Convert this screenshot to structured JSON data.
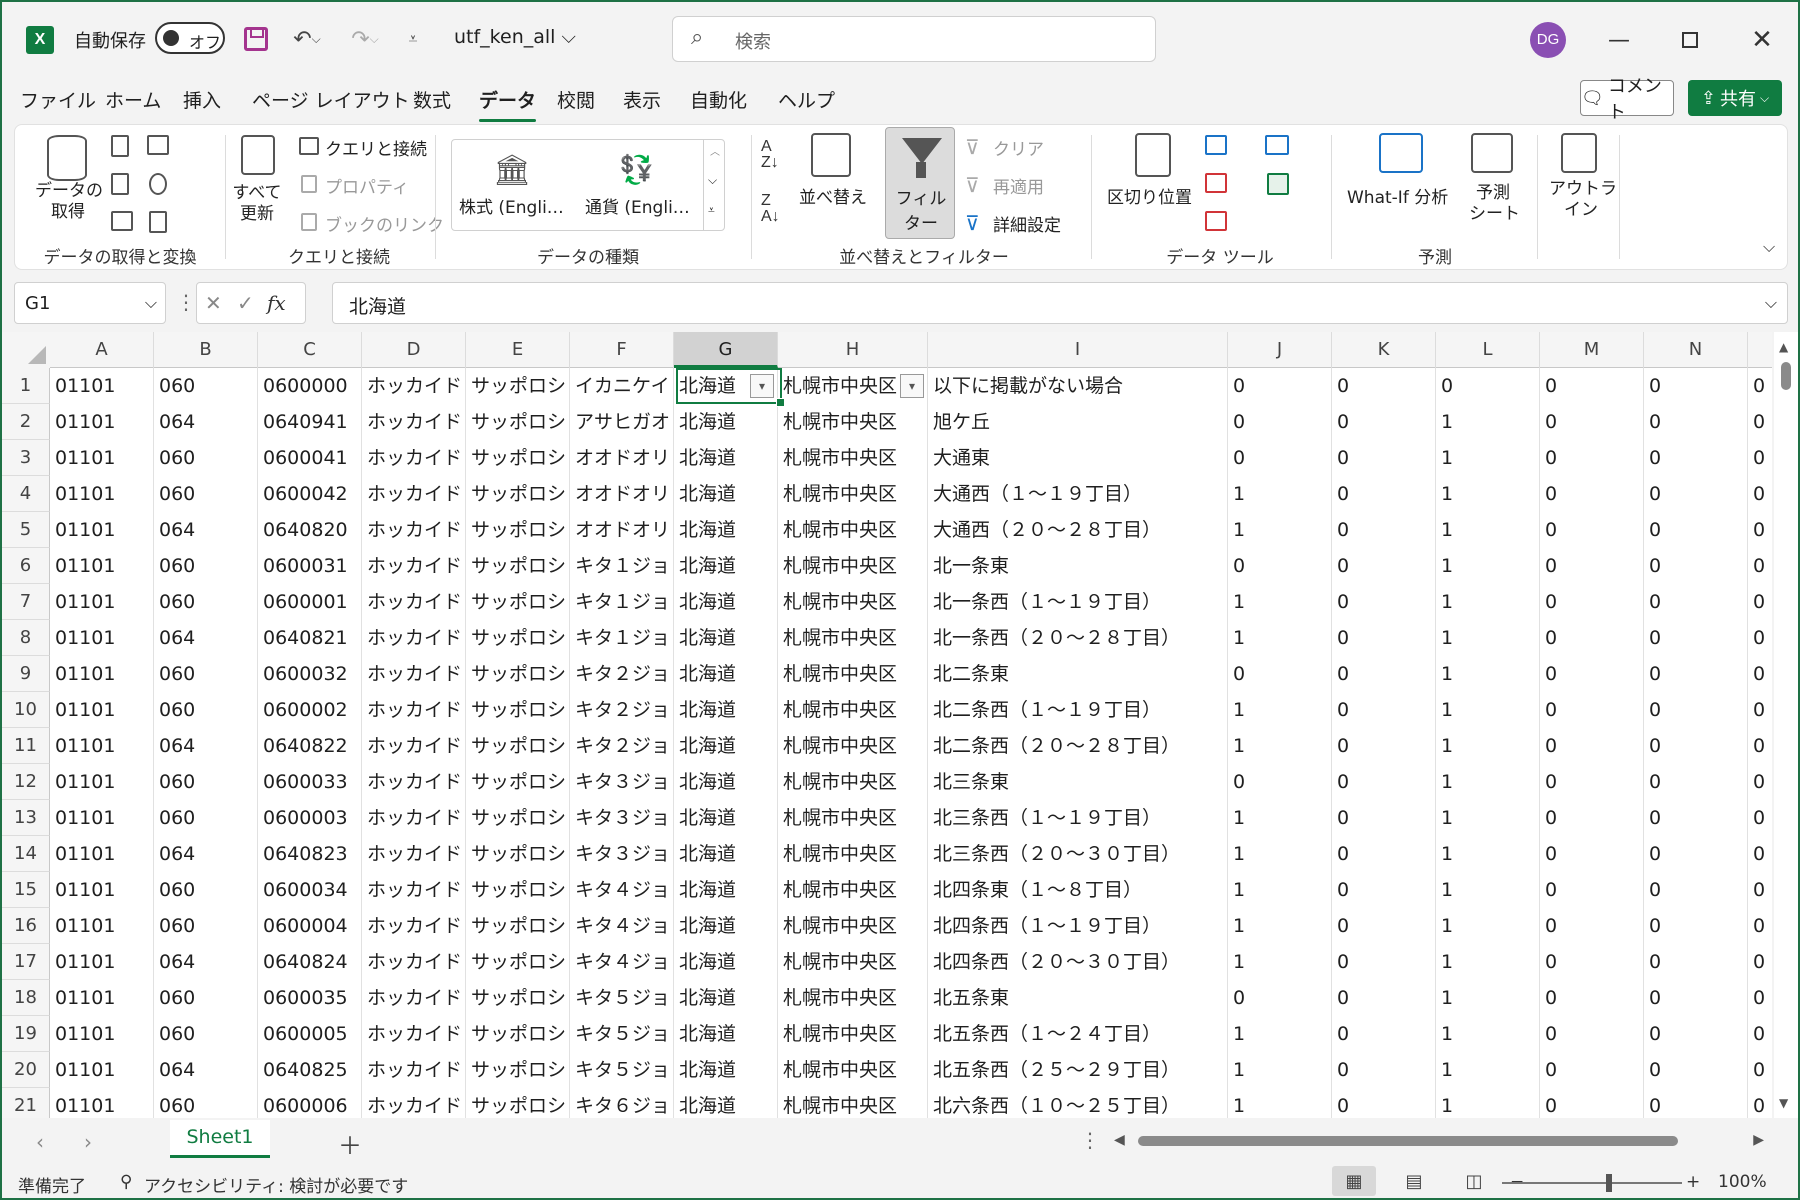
{
  "titlebar": {
    "autosave_label": "自動保存",
    "autosave_state": "オフ",
    "doc_name": "utf_ken_all ⌵",
    "search_placeholder": "検索",
    "avatar_initials": "DG"
  },
  "tabs": [
    "ファイル",
    "ホーム",
    "挿入",
    "ページ レイアウト",
    "数式",
    "データ",
    "校閲",
    "表示",
    "自動化",
    "ヘルプ"
  ],
  "active_tab": "データ",
  "comment_label": "コメント",
  "share_label": "共有",
  "ribbon": {
    "get_data": "データの\n取得",
    "group_get_transform": "データの取得と変換",
    "refresh_all": "すべて\n更新",
    "queries_connections": "クエリと接続",
    "properties": "プロパティ",
    "book_links": "ブックのリンク",
    "group_queries": "クエリと接続",
    "stocks": "株式 (Engli…",
    "currencies": "通貨 (Engli…",
    "group_datatypes": "データの種類",
    "sort": "並べ替え",
    "filter": "フィルター",
    "clear": "クリア",
    "reapply": "再適用",
    "advanced": "詳細設定",
    "group_sort_filter": "並べ替えとフィルター",
    "text_to_columns": "区切り位置",
    "group_data_tools": "データ ツール",
    "whatif": "What-If 分析",
    "forecast_sheet": "予測\nシート",
    "group_forecast": "予測",
    "outline": "アウトラ\nイン"
  },
  "formula_bar": {
    "name_box": "G1",
    "formula": "北海道"
  },
  "grid": {
    "columns": [
      "A",
      "B",
      "C",
      "D",
      "E",
      "F",
      "G",
      "H",
      "I",
      "J",
      "K",
      "L",
      "M",
      "N"
    ],
    "selected_column": "G",
    "selected_cell": "G1",
    "row_numbers": [
      "1",
      "2",
      "3",
      "4",
      "5",
      "6",
      "7",
      "8",
      "9",
      "10",
      "11",
      "12",
      "13",
      "14",
      "15",
      "16",
      "17",
      "18",
      "19",
      "20",
      "21"
    ],
    "rows": [
      [
        "01101",
        "060",
        "0600000",
        "ホッカイド",
        "サッポロシ",
        "イカニケイ",
        "北海道",
        "札幌市中央区",
        "以下に掲載がない場合",
        "0",
        "0",
        "0",
        "0",
        "0",
        "0"
      ],
      [
        "01101",
        "064",
        "0640941",
        "ホッカイド",
        "サッポロシ",
        "アサヒガオ",
        "北海道",
        "札幌市中央区",
        "旭ケ丘",
        "0",
        "0",
        "1",
        "0",
        "0",
        "0"
      ],
      [
        "01101",
        "060",
        "0600041",
        "ホッカイド",
        "サッポロシ",
        "オオドオリ",
        "北海道",
        "札幌市中央区",
        "大通東",
        "0",
        "0",
        "1",
        "0",
        "0",
        "0"
      ],
      [
        "01101",
        "060",
        "0600042",
        "ホッカイド",
        "サッポロシ",
        "オオドオリ",
        "北海道",
        "札幌市中央区",
        "大通西（１～１９丁目）",
        "1",
        "0",
        "1",
        "0",
        "0",
        "0"
      ],
      [
        "01101",
        "064",
        "0640820",
        "ホッカイド",
        "サッポロシ",
        "オオドオリ",
        "北海道",
        "札幌市中央区",
        "大通西（２０～２８丁目）",
        "1",
        "0",
        "1",
        "0",
        "0",
        "0"
      ],
      [
        "01101",
        "060",
        "0600031",
        "ホッカイド",
        "サッポロシ",
        "キタ１ジョ",
        "北海道",
        "札幌市中央区",
        "北一条東",
        "0",
        "0",
        "1",
        "0",
        "0",
        "0"
      ],
      [
        "01101",
        "060",
        "0600001",
        "ホッカイド",
        "サッポロシ",
        "キタ１ジョ",
        "北海道",
        "札幌市中央区",
        "北一条西（１～１９丁目）",
        "1",
        "0",
        "1",
        "0",
        "0",
        "0"
      ],
      [
        "01101",
        "064",
        "0640821",
        "ホッカイド",
        "サッポロシ",
        "キタ１ジョ",
        "北海道",
        "札幌市中央区",
        "北一条西（２０～２８丁目）",
        "1",
        "0",
        "1",
        "0",
        "0",
        "0"
      ],
      [
        "01101",
        "060",
        "0600032",
        "ホッカイド",
        "サッポロシ",
        "キタ２ジョ",
        "北海道",
        "札幌市中央区",
        "北二条東",
        "0",
        "0",
        "1",
        "0",
        "0",
        "0"
      ],
      [
        "01101",
        "060",
        "0600002",
        "ホッカイド",
        "サッポロシ",
        "キタ２ジョ",
        "北海道",
        "札幌市中央区",
        "北二条西（１～１９丁目）",
        "1",
        "0",
        "1",
        "0",
        "0",
        "0"
      ],
      [
        "01101",
        "064",
        "0640822",
        "ホッカイド",
        "サッポロシ",
        "キタ２ジョ",
        "北海道",
        "札幌市中央区",
        "北二条西（２０～２８丁目）",
        "1",
        "0",
        "1",
        "0",
        "0",
        "0"
      ],
      [
        "01101",
        "060",
        "0600033",
        "ホッカイド",
        "サッポロシ",
        "キタ３ジョ",
        "北海道",
        "札幌市中央区",
        "北三条東",
        "0",
        "0",
        "1",
        "0",
        "0",
        "0"
      ],
      [
        "01101",
        "060",
        "0600003",
        "ホッカイド",
        "サッポロシ",
        "キタ３ジョ",
        "北海道",
        "札幌市中央区",
        "北三条西（１～１９丁目）",
        "1",
        "0",
        "1",
        "0",
        "0",
        "0"
      ],
      [
        "01101",
        "064",
        "0640823",
        "ホッカイド",
        "サッポロシ",
        "キタ３ジョ",
        "北海道",
        "札幌市中央区",
        "北三条西（２０～３０丁目）",
        "1",
        "0",
        "1",
        "0",
        "0",
        "0"
      ],
      [
        "01101",
        "060",
        "0600034",
        "ホッカイド",
        "サッポロシ",
        "キタ４ジョ",
        "北海道",
        "札幌市中央区",
        "北四条東（１～８丁目）",
        "1",
        "0",
        "1",
        "0",
        "0",
        "0"
      ],
      [
        "01101",
        "060",
        "0600004",
        "ホッカイド",
        "サッポロシ",
        "キタ４ジョ",
        "北海道",
        "札幌市中央区",
        "北四条西（１～１９丁目）",
        "1",
        "0",
        "1",
        "0",
        "0",
        "0"
      ],
      [
        "01101",
        "064",
        "0640824",
        "ホッカイド",
        "サッポロシ",
        "キタ４ジョ",
        "北海道",
        "札幌市中央区",
        "北四条西（２０～３０丁目）",
        "1",
        "0",
        "1",
        "0",
        "0",
        "0"
      ],
      [
        "01101",
        "060",
        "0600035",
        "ホッカイド",
        "サッポロシ",
        "キタ５ジョ",
        "北海道",
        "札幌市中央区",
        "北五条東",
        "0",
        "0",
        "1",
        "0",
        "0",
        "0"
      ],
      [
        "01101",
        "060",
        "0600005",
        "ホッカイド",
        "サッポロシ",
        "キタ５ジョ",
        "北海道",
        "札幌市中央区",
        "北五条西（１～２４丁目）",
        "1",
        "0",
        "1",
        "0",
        "0",
        "0"
      ],
      [
        "01101",
        "064",
        "0640825",
        "ホッカイド",
        "サッポロシ",
        "キタ５ジョ",
        "北海道",
        "札幌市中央区",
        "北五条西（２５～２９丁目）",
        "1",
        "0",
        "1",
        "0",
        "0",
        "0"
      ],
      [
        "01101",
        "060",
        "0600006",
        "ホッカイド",
        "サッポロシ",
        "キタ６ジョ",
        "北海道",
        "札幌市中央区",
        "北六条西（１０～２５丁目）",
        "1",
        "0",
        "1",
        "0",
        "0",
        "0"
      ]
    ]
  },
  "sheet_tabs": [
    "Sheet1"
  ],
  "status": {
    "ready": "準備完了",
    "accessibility": "アクセシビリティ: 検討が必要です",
    "zoom": "100%"
  },
  "colors": {
    "accent": "#107c41",
    "avatar": "#8a4fb3"
  }
}
